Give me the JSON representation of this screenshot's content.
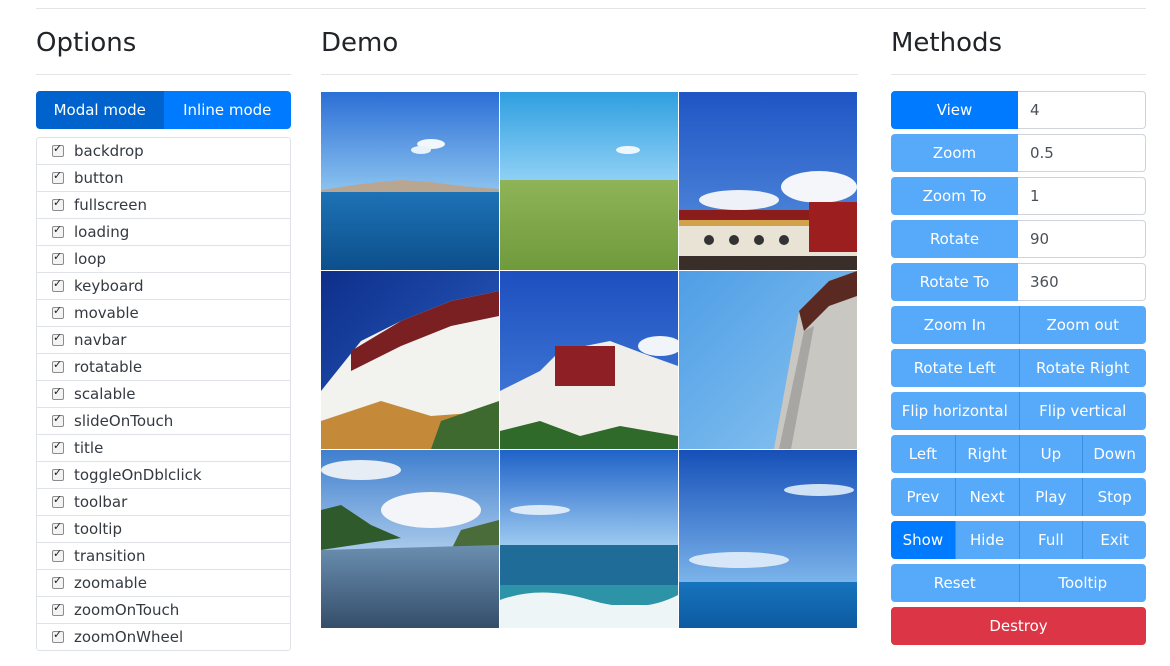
{
  "options": {
    "title": "Options",
    "modes": [
      {
        "label": "Modal mode",
        "active": true
      },
      {
        "label": "Inline mode",
        "active": false
      }
    ],
    "checkboxes": [
      {
        "label": "backdrop",
        "checked": true
      },
      {
        "label": "button",
        "checked": true
      },
      {
        "label": "fullscreen",
        "checked": true
      },
      {
        "label": "loading",
        "checked": true
      },
      {
        "label": "loop",
        "checked": true
      },
      {
        "label": "keyboard",
        "checked": true
      },
      {
        "label": "movable",
        "checked": true
      },
      {
        "label": "navbar",
        "checked": true
      },
      {
        "label": "rotatable",
        "checked": true
      },
      {
        "label": "scalable",
        "checked": true
      },
      {
        "label": "slideOnTouch",
        "checked": true
      },
      {
        "label": "title",
        "checked": true
      },
      {
        "label": "toggleOnDblclick",
        "checked": true
      },
      {
        "label": "toolbar",
        "checked": true
      },
      {
        "label": "tooltip",
        "checked": true
      },
      {
        "label": "transition",
        "checked": true
      },
      {
        "label": "zoomable",
        "checked": true
      },
      {
        "label": "zoomOnTouch",
        "checked": true
      },
      {
        "label": "zoomOnWheel",
        "checked": true
      }
    ]
  },
  "demo": {
    "title": "Demo",
    "images": [
      {
        "subject": "lake with mountains and sky"
      },
      {
        "subject": "green grassland under blue sky"
      },
      {
        "subject": "temple roof with clouds"
      },
      {
        "subject": "potala palace from below"
      },
      {
        "subject": "potala palace wide view"
      },
      {
        "subject": "white palace wall against sky"
      },
      {
        "subject": "river channel with trees and clouds"
      },
      {
        "subject": "sea waves under blue sky"
      },
      {
        "subject": "ocean horizon with clouds"
      }
    ]
  },
  "methods": {
    "title": "Methods",
    "view": {
      "label": "View",
      "value": "4"
    },
    "zoom": {
      "label": "Zoom",
      "value": "0.5"
    },
    "zoom_to": {
      "label": "Zoom To",
      "value": "1"
    },
    "rotate": {
      "label": "Rotate",
      "value": "90"
    },
    "rotate_to": {
      "label": "Rotate To",
      "value": "360"
    },
    "zoom_in": "Zoom In",
    "zoom_out": "Zoom out",
    "rotate_left": "Rotate Left",
    "rotate_right": "Rotate Right",
    "flip_horizontal": "Flip horizontal",
    "flip_vertical": "Flip vertical",
    "left": "Left",
    "right": "Right",
    "up": "Up",
    "down": "Down",
    "prev": "Prev",
    "next": "Next",
    "play": "Play",
    "stop": "Stop",
    "show": "Show",
    "hide": "Hide",
    "full": "Full",
    "exit": "Exit",
    "reset": "Reset",
    "tooltip": "Tooltip",
    "destroy": "Destroy"
  },
  "colors": {
    "primary": "#007bff",
    "primary_active": "#0062cc",
    "light_primary": "#57a9f9",
    "danger": "#dc3545"
  }
}
